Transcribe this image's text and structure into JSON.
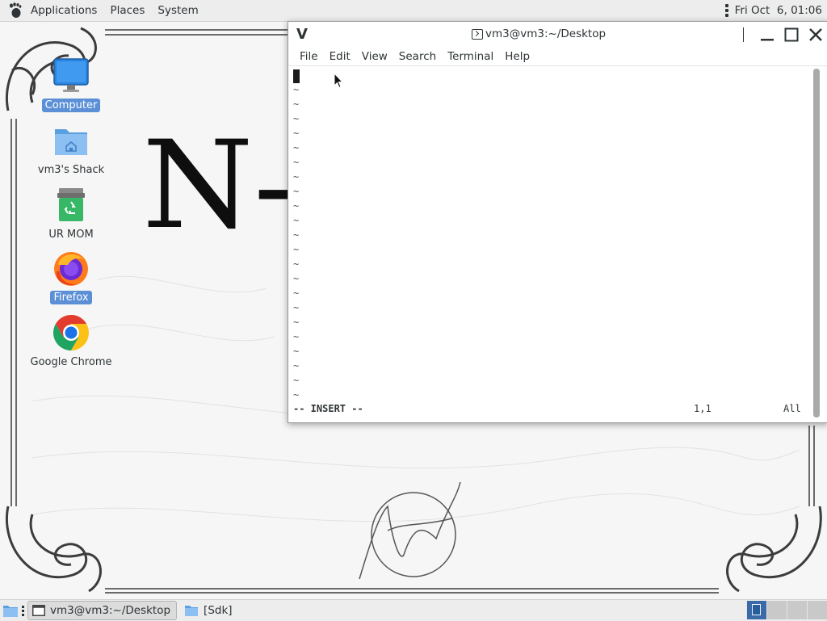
{
  "top_panel": {
    "menu": [
      "Applications",
      "Places",
      "System"
    ],
    "clock": "Fri Oct  6, 01:06"
  },
  "wallpaper": {
    "text": "N-"
  },
  "desktop_icons": [
    {
      "label": "Computer",
      "icon": "computer-icon",
      "selected": true
    },
    {
      "label": "vm3's Shack",
      "icon": "home-folder-icon",
      "selected": false
    },
    {
      "label": "UR MOM",
      "icon": "trash-icon",
      "selected": false
    },
    {
      "label": "Firefox",
      "icon": "firefox-icon",
      "selected": true
    },
    {
      "label": "Google Chrome",
      "icon": "chrome-icon",
      "selected": false
    }
  ],
  "terminal": {
    "app_letter": "V",
    "title": "vm3@vm3:~/Desktop",
    "menu": [
      "File",
      "Edit",
      "View",
      "Search",
      "Terminal",
      "Help"
    ],
    "empty_line_marker": "~",
    "empty_line_count": 22,
    "status_mode": "-- INSERT --",
    "status_position": "1,1",
    "status_scroll": "All"
  },
  "taskbar": {
    "tasks": [
      {
        "label": "vm3@vm3:~/Desktop",
        "icon": "terminal-icon",
        "active": true
      },
      {
        "label": "[Sdk]",
        "icon": "folder-icon",
        "active": false
      }
    ],
    "workspace_count": 4,
    "active_workspace": 1
  },
  "colors": {
    "selection": "#5b8fd6",
    "active_workspace": "#3b6aa8",
    "panel_bg": "#ededed"
  }
}
